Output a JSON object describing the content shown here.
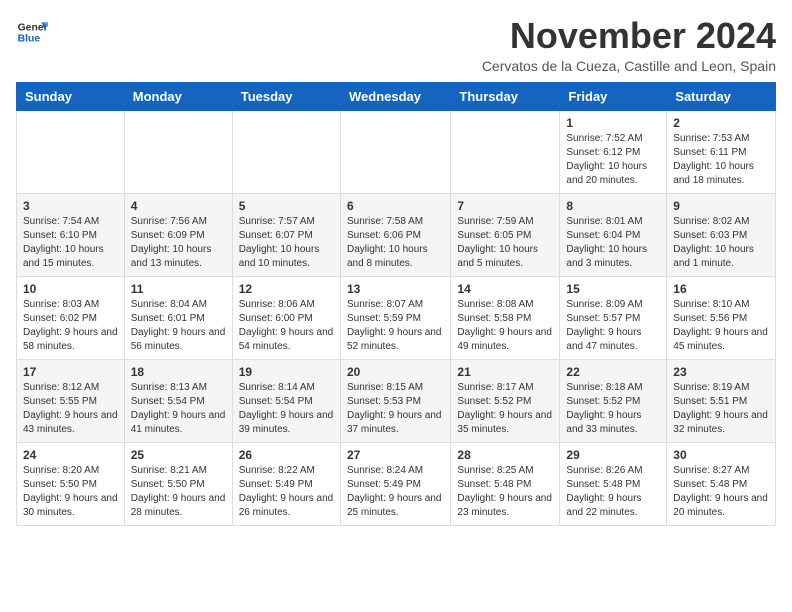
{
  "header": {
    "logo_line1": "General",
    "logo_line2": "Blue",
    "month_title": "November 2024",
    "location": "Cervatos de la Cueza, Castille and Leon, Spain"
  },
  "weekdays": [
    "Sunday",
    "Monday",
    "Tuesday",
    "Wednesday",
    "Thursday",
    "Friday",
    "Saturday"
  ],
  "weeks": [
    [
      {
        "day": "",
        "info": ""
      },
      {
        "day": "",
        "info": ""
      },
      {
        "day": "",
        "info": ""
      },
      {
        "day": "",
        "info": ""
      },
      {
        "day": "",
        "info": ""
      },
      {
        "day": "1",
        "info": "Sunrise: 7:52 AM\nSunset: 6:12 PM\nDaylight: 10 hours and 20 minutes."
      },
      {
        "day": "2",
        "info": "Sunrise: 7:53 AM\nSunset: 6:11 PM\nDaylight: 10 hours and 18 minutes."
      }
    ],
    [
      {
        "day": "3",
        "info": "Sunrise: 7:54 AM\nSunset: 6:10 PM\nDaylight: 10 hours and 15 minutes."
      },
      {
        "day": "4",
        "info": "Sunrise: 7:56 AM\nSunset: 6:09 PM\nDaylight: 10 hours and 13 minutes."
      },
      {
        "day": "5",
        "info": "Sunrise: 7:57 AM\nSunset: 6:07 PM\nDaylight: 10 hours and 10 minutes."
      },
      {
        "day": "6",
        "info": "Sunrise: 7:58 AM\nSunset: 6:06 PM\nDaylight: 10 hours and 8 minutes."
      },
      {
        "day": "7",
        "info": "Sunrise: 7:59 AM\nSunset: 6:05 PM\nDaylight: 10 hours and 5 minutes."
      },
      {
        "day": "8",
        "info": "Sunrise: 8:01 AM\nSunset: 6:04 PM\nDaylight: 10 hours and 3 minutes."
      },
      {
        "day": "9",
        "info": "Sunrise: 8:02 AM\nSunset: 6:03 PM\nDaylight: 10 hours and 1 minute."
      }
    ],
    [
      {
        "day": "10",
        "info": "Sunrise: 8:03 AM\nSunset: 6:02 PM\nDaylight: 9 hours and 58 minutes."
      },
      {
        "day": "11",
        "info": "Sunrise: 8:04 AM\nSunset: 6:01 PM\nDaylight: 9 hours and 56 minutes."
      },
      {
        "day": "12",
        "info": "Sunrise: 8:06 AM\nSunset: 6:00 PM\nDaylight: 9 hours and 54 minutes."
      },
      {
        "day": "13",
        "info": "Sunrise: 8:07 AM\nSunset: 5:59 PM\nDaylight: 9 hours and 52 minutes."
      },
      {
        "day": "14",
        "info": "Sunrise: 8:08 AM\nSunset: 5:58 PM\nDaylight: 9 hours and 49 minutes."
      },
      {
        "day": "15",
        "info": "Sunrise: 8:09 AM\nSunset: 5:57 PM\nDaylight: 9 hours and 47 minutes."
      },
      {
        "day": "16",
        "info": "Sunrise: 8:10 AM\nSunset: 5:56 PM\nDaylight: 9 hours and 45 minutes."
      }
    ],
    [
      {
        "day": "17",
        "info": "Sunrise: 8:12 AM\nSunset: 5:55 PM\nDaylight: 9 hours and 43 minutes."
      },
      {
        "day": "18",
        "info": "Sunrise: 8:13 AM\nSunset: 5:54 PM\nDaylight: 9 hours and 41 minutes."
      },
      {
        "day": "19",
        "info": "Sunrise: 8:14 AM\nSunset: 5:54 PM\nDaylight: 9 hours and 39 minutes."
      },
      {
        "day": "20",
        "info": "Sunrise: 8:15 AM\nSunset: 5:53 PM\nDaylight: 9 hours and 37 minutes."
      },
      {
        "day": "21",
        "info": "Sunrise: 8:17 AM\nSunset: 5:52 PM\nDaylight: 9 hours and 35 minutes."
      },
      {
        "day": "22",
        "info": "Sunrise: 8:18 AM\nSunset: 5:52 PM\nDaylight: 9 hours and 33 minutes."
      },
      {
        "day": "23",
        "info": "Sunrise: 8:19 AM\nSunset: 5:51 PM\nDaylight: 9 hours and 32 minutes."
      }
    ],
    [
      {
        "day": "24",
        "info": "Sunrise: 8:20 AM\nSunset: 5:50 PM\nDaylight: 9 hours and 30 minutes."
      },
      {
        "day": "25",
        "info": "Sunrise: 8:21 AM\nSunset: 5:50 PM\nDaylight: 9 hours and 28 minutes."
      },
      {
        "day": "26",
        "info": "Sunrise: 8:22 AM\nSunset: 5:49 PM\nDaylight: 9 hours and 26 minutes."
      },
      {
        "day": "27",
        "info": "Sunrise: 8:24 AM\nSunset: 5:49 PM\nDaylight: 9 hours and 25 minutes."
      },
      {
        "day": "28",
        "info": "Sunrise: 8:25 AM\nSunset: 5:48 PM\nDaylight: 9 hours and 23 minutes."
      },
      {
        "day": "29",
        "info": "Sunrise: 8:26 AM\nSunset: 5:48 PM\nDaylight: 9 hours and 22 minutes."
      },
      {
        "day": "30",
        "info": "Sunrise: 8:27 AM\nSunset: 5:48 PM\nDaylight: 9 hours and 20 minutes."
      }
    ]
  ]
}
